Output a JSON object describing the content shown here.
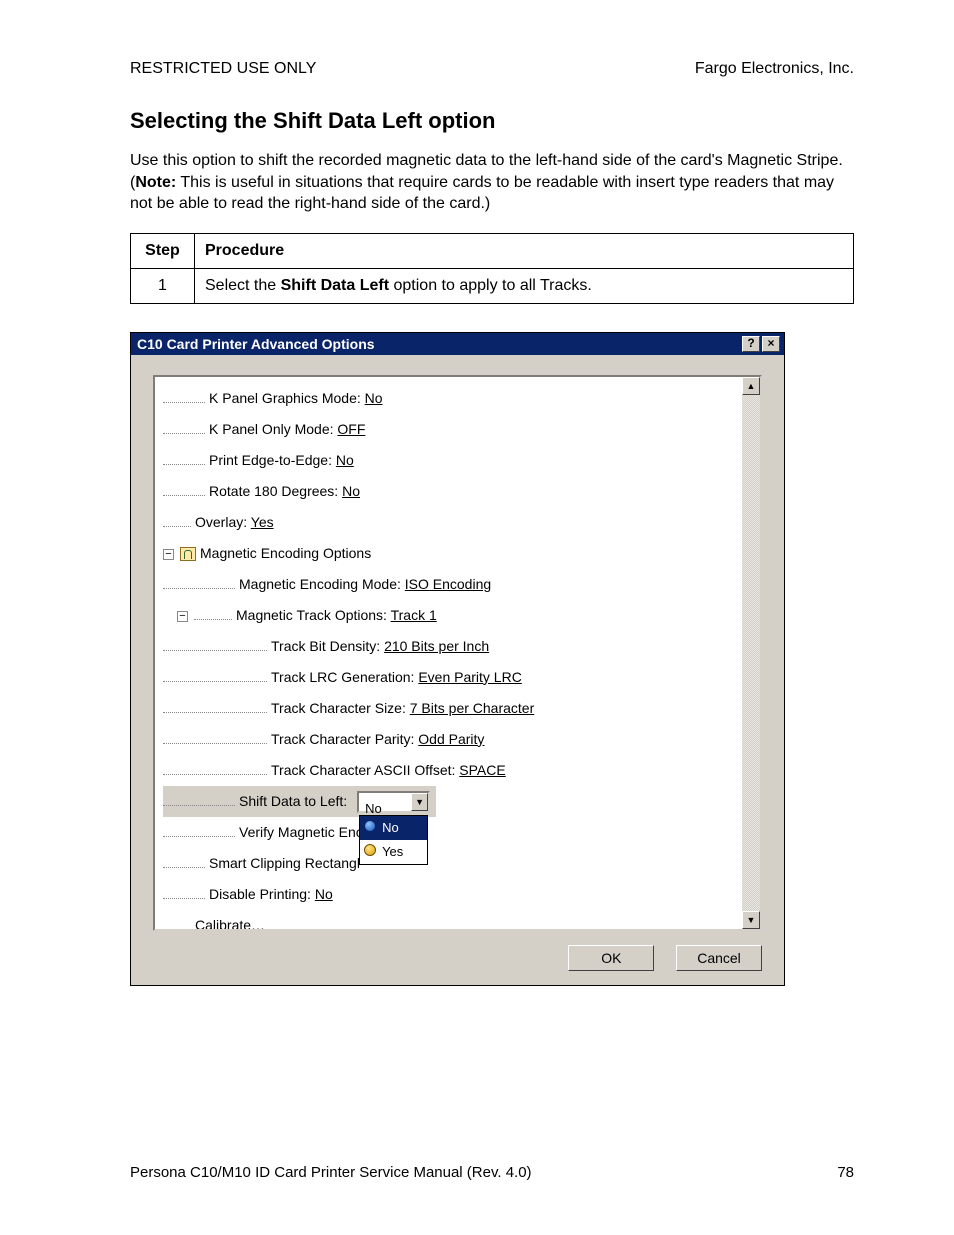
{
  "header": {
    "left": "RESTRICTED USE ONLY",
    "right": "Fargo Electronics, Inc."
  },
  "heading": "Selecting the Shift Data Left option",
  "intro_pre": "Use this option to shift the recorded magnetic data to the left-hand side of the card's Magnetic Stripe. (",
  "intro_bold": "Note:",
  "intro_post": "  This is useful in situations that require cards to be readable with insert type readers that may not be able to read the right-hand side of the card.)",
  "table": {
    "head_step": "Step",
    "head_proc": "Procedure",
    "rows": [
      {
        "step": "1",
        "pre": "Select the ",
        "bold": "Shift Data Left",
        "post": " option to apply to all Tracks."
      }
    ]
  },
  "dialog": {
    "title": "C10 Card Printer Advanced Options",
    "help_glyph": "?",
    "close_glyph": "×",
    "scroll_up": "▲",
    "scroll_down": "▼",
    "tree": {
      "k_panel_graphics_label": "K Panel Graphics Mode: ",
      "k_panel_graphics_value": "No",
      "k_panel_only_label": "K Panel Only Mode: ",
      "k_panel_only_value": "OFF",
      "edge_label": "Print Edge-to-Edge: ",
      "edge_value": "No",
      "rotate_label": "Rotate 180 Degrees: ",
      "rotate_value": "No",
      "overlay_label": "Overlay: ",
      "overlay_value": "Yes",
      "mag_group": "Magnetic Encoding Options",
      "mag_mode_label": "Magnetic Encoding Mode: ",
      "mag_mode_value": "ISO Encoding",
      "mag_track_label": "Magnetic Track Options: ",
      "mag_track_value": "Track 1",
      "density_label": "Track Bit Density: ",
      "density_value": "210 Bits per Inch",
      "lrc_label": "Track LRC Generation: ",
      "lrc_value": "Even Parity LRC",
      "charsize_label": "Track Character Size: ",
      "charsize_value": "7 Bits per Character",
      "parity_label": "Track Character Parity: ",
      "parity_value": "Odd Parity",
      "ascii_label": "Track Character ASCII Offset: ",
      "ascii_value": "SPACE",
      "shift_label": "Shift Data to Left:",
      "shift_combo_value": "No",
      "shift_combo_btn": "▼",
      "shift_options": {
        "no": "No",
        "yes": "Yes"
      },
      "verify_label": "Verify Magnetic Enc",
      "smart_label": "Smart Clipping Rectangl",
      "disable_label": "Disable Printing: ",
      "disable_value": "No",
      "calibrate": "Calibrate…"
    },
    "ok": "OK",
    "cancel": "Cancel"
  },
  "footer": {
    "left": "Persona C10/M10 ID Card Printer Service Manual (Rev. 4.0)",
    "page": "78"
  }
}
